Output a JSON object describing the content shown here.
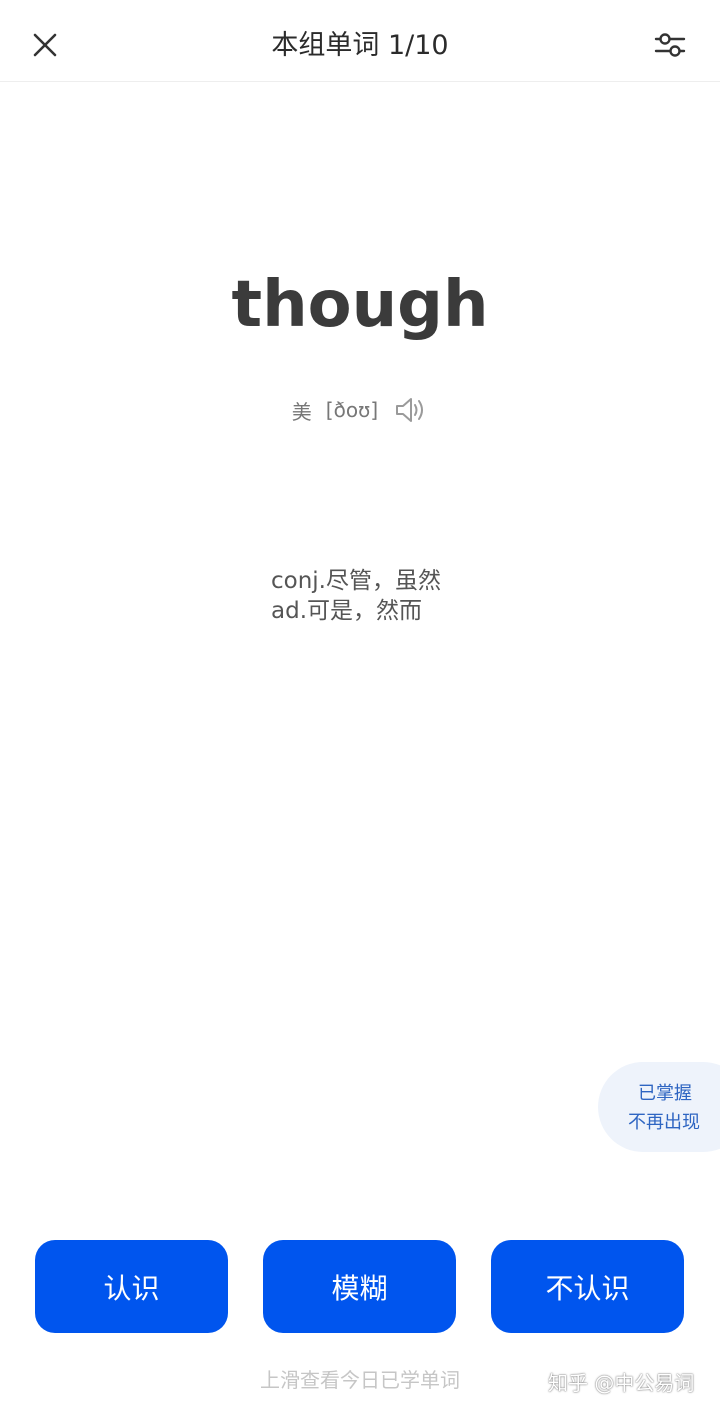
{
  "header": {
    "title": "本组单词 1/10"
  },
  "card": {
    "word": "though",
    "phonetic": {
      "region": "美",
      "ipa": "[ðoʊ]"
    },
    "definitions": [
      "conj.尽管，虽然",
      "ad.可是，然而"
    ]
  },
  "mastered": {
    "line1": "已掌握",
    "line2": "不再出现"
  },
  "actions": {
    "know": "认识",
    "fuzzy": "模糊",
    "unknown": "不认识"
  },
  "footer": {
    "hint": "上滑查看今日已学单词",
    "watermark": "知乎 @中公易词"
  },
  "colors": {
    "primary": "#0055ee",
    "mastered_bg": "#eef3fb",
    "mastered_text": "#2e65c2"
  },
  "icons": {
    "close": "close-icon",
    "settings": "sliders-icon",
    "speaker": "speaker-icon"
  }
}
